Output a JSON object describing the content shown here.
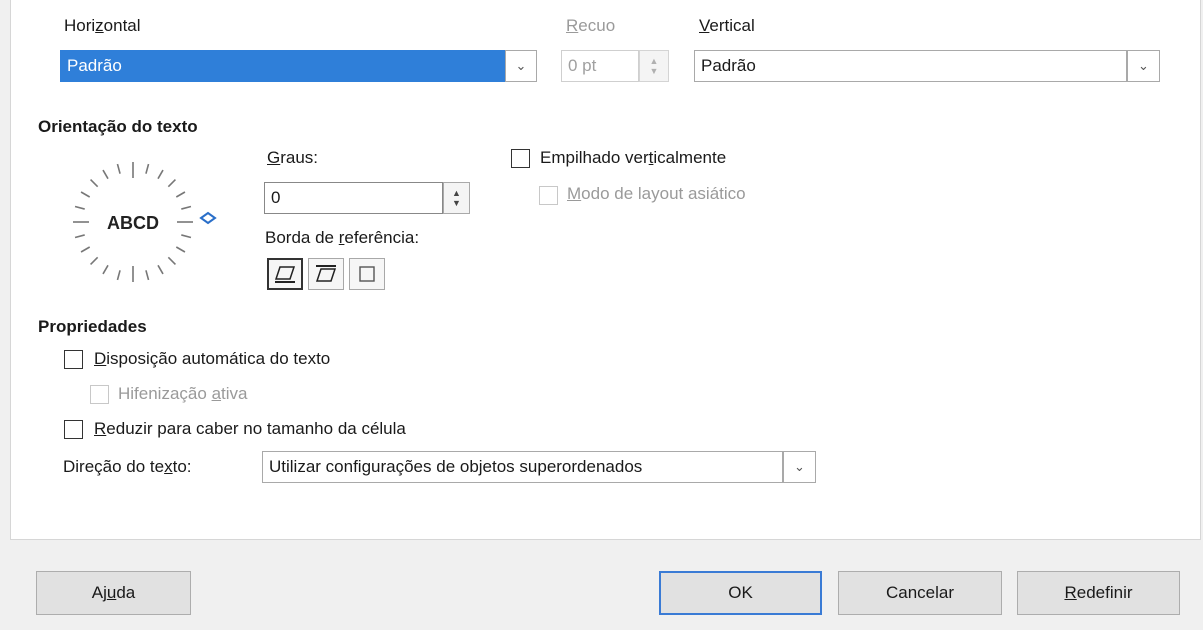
{
  "alignment": {
    "horizontal_label_pre": "Hori",
    "horizontal_label_key": "z",
    "horizontal_label_post": "ontal",
    "horizontal_value": "Padrão",
    "indent_label_key": "R",
    "indent_label_post": "ecuo",
    "indent_value": "0 pt",
    "vertical_label_key": "V",
    "vertical_label_post": "ertical",
    "vertical_value": "Padrão"
  },
  "orientation": {
    "heading": "Orientação do texto",
    "dial_text": "ABCD",
    "degrees_label_key": "G",
    "degrees_label_post": "raus:",
    "degrees_value": "0",
    "reference_label_pre": "Borda de ",
    "reference_label_key": "r",
    "reference_label_post": "eferência:",
    "stacked_pre": "Empilhado ver",
    "stacked_key": "t",
    "stacked_post": "icalmente",
    "asian_key": "M",
    "asian_post": "odo de layout asiático"
  },
  "properties": {
    "heading": "Propriedades",
    "wrap_key": "D",
    "wrap_post": "isposição automática do texto",
    "hyphen_pre": "Hifenização ",
    "hyphen_key": "a",
    "hyphen_post": "tiva",
    "shrink_key": "R",
    "shrink_post": "eduzir para caber no tamanho da célula",
    "direction_label_pre": "Direção do te",
    "direction_label_key": "x",
    "direction_label_post": "to:",
    "direction_value": "Utilizar configurações de objetos superordenados"
  },
  "buttons": {
    "help_pre": "Aj",
    "help_key": "u",
    "help_post": "da",
    "ok": "OK",
    "cancel": "Cancelar",
    "reset_key": "R",
    "reset_post": "edefinir"
  },
  "colors": {
    "selection": "#2f7fd9",
    "default_button_border": "#3a7bd5",
    "dial_marker": "#2a6fc9"
  }
}
